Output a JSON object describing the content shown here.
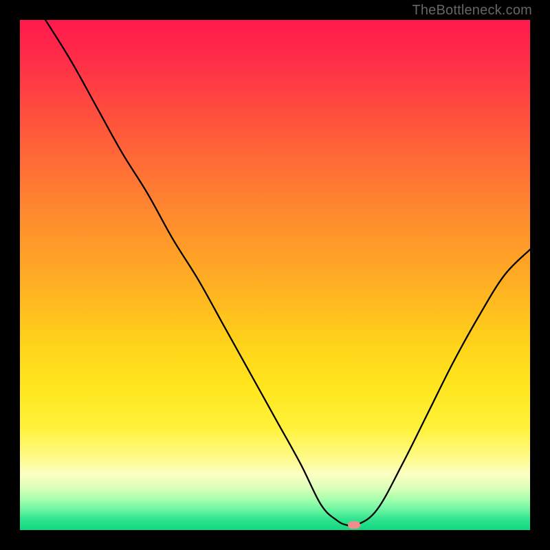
{
  "watermark": "TheBottleneck.com",
  "chart_data": {
    "type": "line",
    "title": "",
    "xlabel": "",
    "ylabel": "",
    "xlim": [
      0,
      100
    ],
    "ylim": [
      0,
      100
    ],
    "series": [
      {
        "name": "curve",
        "x": [
          5,
          10,
          15,
          20,
          25,
          30,
          35,
          40,
          45,
          50,
          55,
          59,
          62,
          64,
          66,
          70,
          75,
          80,
          85,
          90,
          95,
          100
        ],
        "y": [
          100,
          92,
          83,
          74,
          66,
          57,
          49,
          40,
          31,
          22,
          13,
          5,
          2,
          1,
          1,
          4,
          13,
          23,
          33,
          42,
          50,
          55
        ]
      }
    ],
    "marker": {
      "x": 65.5,
      "y": 1
    },
    "colors": {
      "curve": "#000000",
      "marker_fill": "#f08c8c",
      "marker_stroke": "#e07272"
    }
  }
}
